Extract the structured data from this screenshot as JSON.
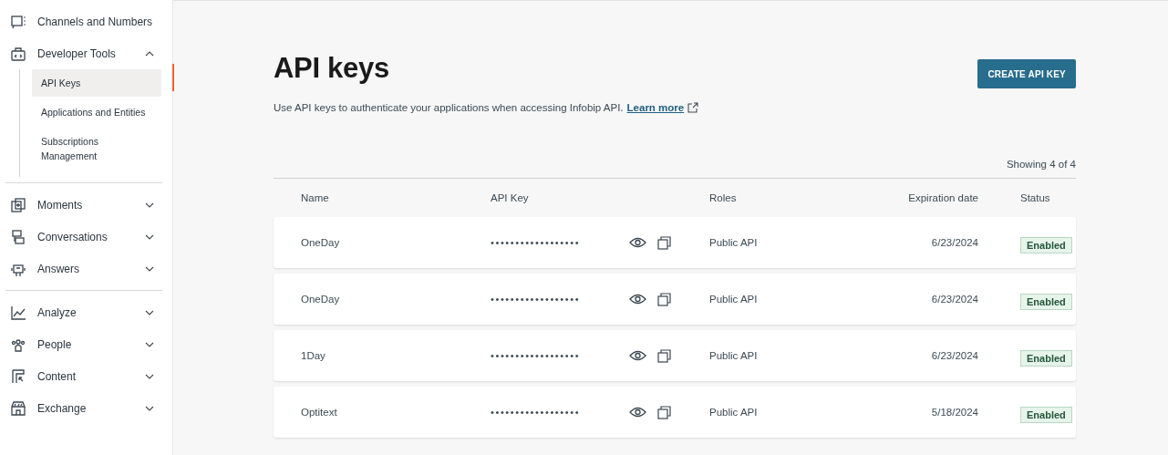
{
  "sidebar": {
    "groups": [
      {
        "items": [
          {
            "label": "Channels and Numbers",
            "kind": "link"
          },
          {
            "label": "Developer Tools",
            "kind": "menu",
            "expanded": true,
            "children": [
              {
                "label": "API Keys",
                "selected": true
              },
              {
                "label": "Applications and Entities",
                "selected": false
              },
              {
                "label": "Subscriptions Management",
                "selected": false
              }
            ]
          }
        ]
      },
      {
        "items": [
          {
            "label": "Moments",
            "kind": "menu",
            "expanded": false
          },
          {
            "label": "Conversations",
            "kind": "menu",
            "expanded": false
          },
          {
            "label": "Answers",
            "kind": "menu",
            "expanded": false
          }
        ]
      },
      {
        "items": [
          {
            "label": "Analyze",
            "kind": "menu",
            "expanded": false
          },
          {
            "label": "People",
            "kind": "menu",
            "expanded": false
          },
          {
            "label": "Content",
            "kind": "menu",
            "expanded": false
          },
          {
            "label": "Exchange",
            "kind": "menu",
            "expanded": false
          }
        ]
      }
    ]
  },
  "page": {
    "title": "API keys",
    "description": "Use API keys to authenticate your applications when accessing Infobip API.",
    "link": "Learn more",
    "create_button": "CREATE API KEY",
    "count": "Showing 4 of 4"
  },
  "table": {
    "columns": [
      "Name",
      "API Key",
      "Roles",
      "Expiration date",
      "Status"
    ],
    "rows": [
      {
        "name": "OneDay",
        "key": "••••••••••••••••••",
        "roles": "Public API",
        "expiration": "6/23/2024",
        "status": "Enabled"
      },
      {
        "name": "OneDay",
        "key": "••••••••••••••••••",
        "roles": "Public API",
        "expiration": "6/23/2024",
        "status": "Enabled"
      },
      {
        "name": "1Day",
        "key": "••••••••••••••••••",
        "roles": "Public API",
        "expiration": "6/23/2024",
        "status": "Enabled"
      },
      {
        "name": "Optitext",
        "key": "••••••••••••••••••",
        "roles": "Public API",
        "expiration": "5/18/2024",
        "status": "Enabled"
      }
    ]
  }
}
